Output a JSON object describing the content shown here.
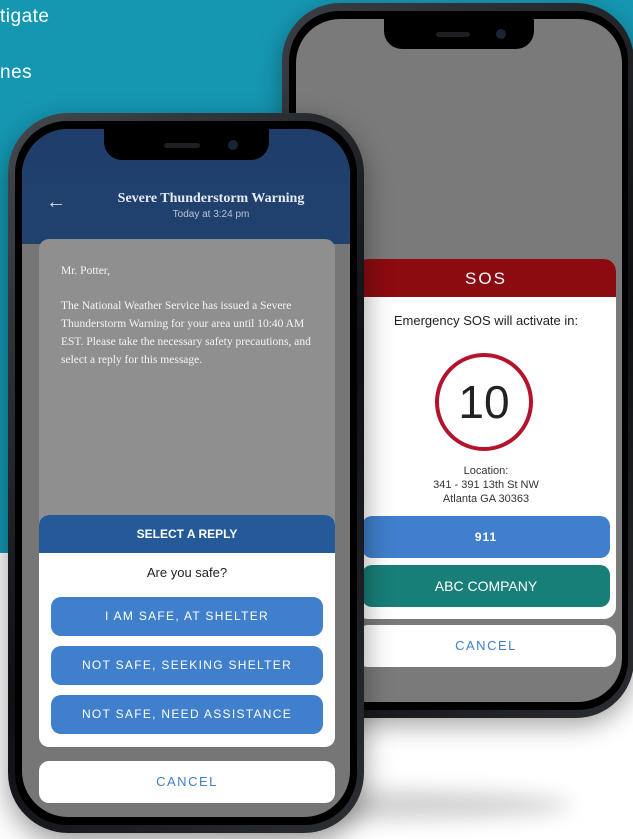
{
  "background": {
    "hero_line1": "tigate",
    "hero_line2": "nes",
    "accent_color": "#1597b2"
  },
  "sos_phone": {
    "header_title": "SOS",
    "countdown_label": "Emergency SOS will activate in:",
    "countdown_value": "10",
    "location_label": "Location:",
    "address_line1": "341 - 391 13th St NW",
    "address_line2": "Atlanta GA 30363",
    "emergency_button": "911",
    "company_button": "ABC COMPANY",
    "cancel_button": "CANCEL",
    "colors": {
      "header": "#8c0b10",
      "ring": "#b3132c",
      "primary": "#3f7fcb",
      "company": "#187e78"
    }
  },
  "message_phone": {
    "back_icon": "arrow-left-icon",
    "title": "Severe Thunderstorm Warning",
    "timestamp": "Today at 3:24 pm",
    "salutation": "Mr. Potter,",
    "body": "The National Weather Service has issued a Severe Thunderstorm Warning for your area until 10:40 AM EST. Please take the necessary safety precautions, and select a reply for this message.",
    "reply_sheet": {
      "title": "SELECT A REPLY",
      "question": "Are you safe?",
      "options": [
        "I AM SAFE, AT SHELTER",
        "NOT SAFE, SEEKING SHELTER",
        "NOT SAFE, NEED ASSISTANCE"
      ]
    },
    "cancel_button": "CANCEL",
    "colors": {
      "header": "#1f3d6b",
      "sheet_header": "#255a99",
      "primary": "#3f7fcb"
    }
  }
}
